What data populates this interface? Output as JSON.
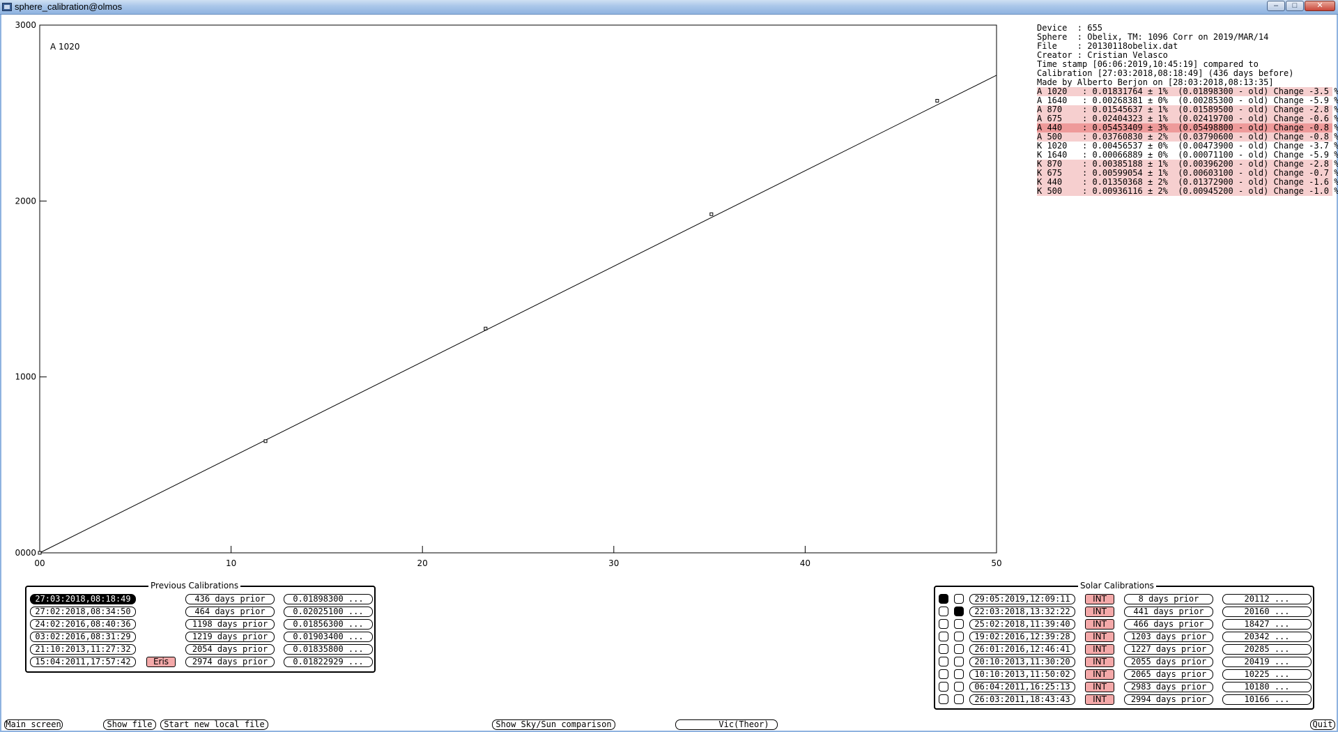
{
  "window": {
    "title": "sphere_calibration@olmos",
    "min_glyph": "‒",
    "max_glyph": "□",
    "close_glyph": "✕"
  },
  "chart_data": {
    "type": "scatter",
    "annotation": "A 1020",
    "xlim": [
      0,
      50
    ],
    "ylim": [
      0,
      3000
    ],
    "x_ticks": [
      10,
      20,
      30,
      40,
      50
    ],
    "y_ticks": [
      1000,
      2000,
      3000
    ],
    "x_origin_label": "00",
    "y_origin_label": "0000",
    "points": [
      {
        "x": 11.8,
        "y": 635
      },
      {
        "x": 23.3,
        "y": 1275
      },
      {
        "x": 35.1,
        "y": 1925
      },
      {
        "x": 46.9,
        "y": 2570
      }
    ],
    "fit_line": {
      "x0": 0,
      "y0": 0,
      "x1": 50,
      "y1": 2715
    }
  },
  "info": {
    "lines": [
      "Device  : 655",
      "Sphere  : Obelix, TM: 1096 Corr on 2019/MAR/14",
      "File    : 20130118obelix.dat",
      "Creator : Cristian Velasco",
      "Time stamp [06:06:2019,10:45:19] compared to",
      "Calibration [27:03:2018,08:18:49] (436 days before)",
      "Made by Alberto Berjon on [28:03:2018,08:13:35]"
    ],
    "calibrations": [
      {
        "text": "A 1020   : 0.01831764 ± 1%  (0.01898300 - old) Change -3.5 %",
        "hl": "light"
      },
      {
        "text": "A 1640   : 0.00268381 ± 0%  (0.00285300 - old) Change -5.9 %",
        "hl": "none"
      },
      {
        "text": "A 870    : 0.01545637 ± 1%  (0.01589500 - old) Change -2.8 %",
        "hl": "light"
      },
      {
        "text": "A 675    : 0.02404323 ± 1%  (0.02419700 - old) Change -0.6 %",
        "hl": "light"
      },
      {
        "text": "A 440    : 0.05453409 ± 3%  (0.05498800 - old) Change -0.8 %",
        "hl": "strong"
      },
      {
        "text": "A 500    : 0.03760830 ± 2%  (0.03790600 - old) Change -0.8 %",
        "hl": "light"
      },
      {
        "text": "K 1020   : 0.00456537 ± 0%  (0.00473900 - old) Change -3.7 %",
        "hl": "none"
      },
      {
        "text": "K 1640   : 0.00066889 ± 0%  (0.00071100 - old) Change -5.9 %",
        "hl": "none"
      },
      {
        "text": "K 870    : 0.00385188 ± 1%  (0.00396200 - old) Change -2.8 %",
        "hl": "light"
      },
      {
        "text": "K 675    : 0.00599054 ± 1%  (0.00603100 - old) Change -0.7 %",
        "hl": "light"
      },
      {
        "text": "K 440    : 0.01350368 ± 2%  (0.01372900 - old) Change -1.6 %",
        "hl": "light"
      },
      {
        "text": "K 500    : 0.00936116 ± 2%  (0.00945200 - old) Change -1.0 %",
        "hl": "light"
      }
    ]
  },
  "previous": {
    "title": "Previous Calibrations",
    "rows": [
      {
        "date": "27:03:2018,08:18:49",
        "selected": true,
        "tag": "",
        "prior": "436 days prior",
        "value": "0.01898300 ..."
      },
      {
        "date": "27:02:2018,08:34:50",
        "selected": false,
        "tag": "",
        "prior": "464 days prior",
        "value": "0.02025100 ..."
      },
      {
        "date": "24:02:2016,08:40:36",
        "selected": false,
        "tag": "",
        "prior": "1198 days prior",
        "value": "0.01856300 ..."
      },
      {
        "date": "03:02:2016,08:31:29",
        "selected": false,
        "tag": "",
        "prior": "1219 days prior",
        "value": "0.01903400 ..."
      },
      {
        "date": "21:10:2013,11:27:32",
        "selected": false,
        "tag": "",
        "prior": "2054 days prior",
        "value": "0.01835800 ..."
      },
      {
        "date": "15:04:2011,17:57:42",
        "selected": false,
        "tag": "Eris",
        "prior": "2974 days prior",
        "value": "0.01822929 ..."
      }
    ]
  },
  "solar": {
    "title": "Solar Calibrations",
    "rows": [
      {
        "c1": true,
        "c2": false,
        "date": "29:05:2019,12:09:11",
        "tag": "INT",
        "prior": "8 days prior",
        "value": "20112 ..."
      },
      {
        "c1": false,
        "c2": true,
        "date": "22:03:2018,13:32:22",
        "tag": "INT",
        "prior": "441 days prior",
        "value": "20160 ..."
      },
      {
        "c1": false,
        "c2": false,
        "date": "25:02:2018,11:39:40",
        "tag": "INT",
        "prior": "466 days prior",
        "value": "18427 ..."
      },
      {
        "c1": false,
        "c2": false,
        "date": "19:02:2016,12:39:28",
        "tag": "INT",
        "prior": "1203 days prior",
        "value": "20342 ..."
      },
      {
        "c1": false,
        "c2": false,
        "date": "26:01:2016,12:46:41",
        "tag": "INT",
        "prior": "1227 days prior",
        "value": "20285 ..."
      },
      {
        "c1": false,
        "c2": false,
        "date": "20:10:2013,11:30:20",
        "tag": "INT",
        "prior": "2055 days prior",
        "value": "20419 ..."
      },
      {
        "c1": false,
        "c2": false,
        "date": "10:10:2013,11:50:02",
        "tag": "INT",
        "prior": "2065 days prior",
        "value": "10225 ..."
      },
      {
        "c1": false,
        "c2": false,
        "date": "06:04:2011,16:25:13",
        "tag": "INT",
        "prior": "2983 days prior",
        "value": "10180 ..."
      },
      {
        "c1": false,
        "c2": false,
        "date": "26:03:2011,18:43:43",
        "tag": "INT",
        "prior": "2994 days prior",
        "value": "10166 ..."
      }
    ]
  },
  "buttons": {
    "main_screen": "Main screen",
    "show_file": "Show file",
    "start_new_local_file": "Start new local file",
    "show_sky_sun": "Show Sky/Sun comparison",
    "vic_theor": "Vic(Theor)",
    "quit": "Quit"
  }
}
